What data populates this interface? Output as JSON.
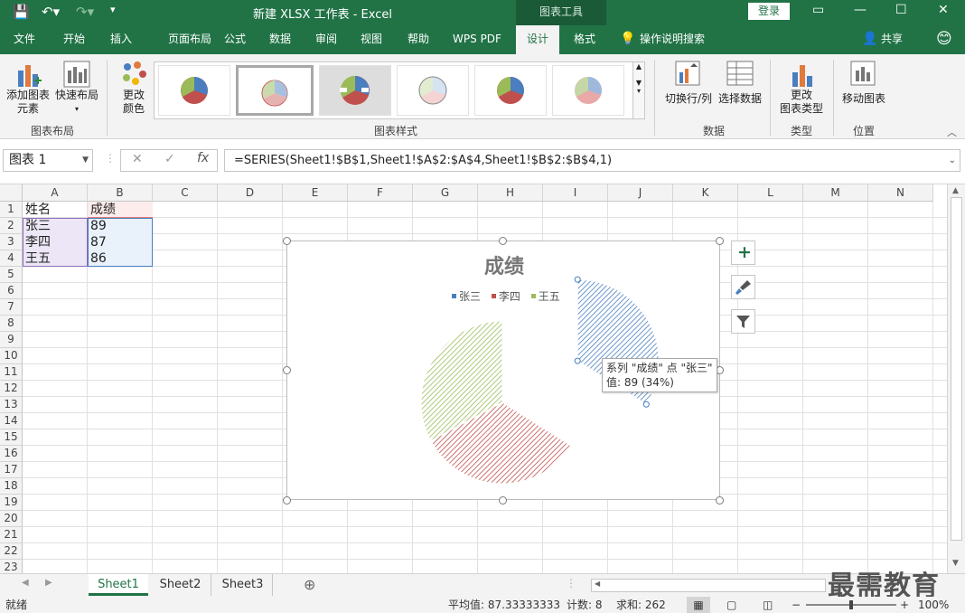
{
  "title_bar": {
    "document_title": "新建 XLSX 工作表 - Excel",
    "context_tools": "图表工具",
    "login_label": "登录"
  },
  "tabs": [
    {
      "label": "文件",
      "x": 0
    },
    {
      "label": "开始"
    },
    {
      "label": "插入"
    },
    {
      "label": "页面布局"
    },
    {
      "label": "公式"
    },
    {
      "label": "数据"
    },
    {
      "label": "审阅"
    },
    {
      "label": "视图"
    },
    {
      "label": "帮助"
    },
    {
      "label": "WPS PDF"
    },
    {
      "label": "设计"
    },
    {
      "label": "格式"
    }
  ],
  "tell_me": "操作说明搜索",
  "share": "共享",
  "ribbon": {
    "add_element": "添加图表\n元素",
    "quick_layout": "快速布局",
    "change_colors": "更改\n颜色",
    "switch_row_col": "切换行/列",
    "select_data": "选择数据",
    "change_type": "更改\n图表类型",
    "move_chart": "移动图表",
    "group_layout": "图表布局",
    "group_styles": "图表样式",
    "group_data": "数据",
    "group_type": "类型",
    "group_location": "位置"
  },
  "name_box": "图表 1",
  "formula": "=SERIES(Sheet1!$B$1,Sheet1!$A$2:$A$4,Sheet1!$B$2:$B$4,1)",
  "columns": [
    "A",
    "B",
    "C",
    "D",
    "E",
    "F",
    "G",
    "H",
    "I",
    "J",
    "K",
    "L",
    "M",
    "N"
  ],
  "rows": [
    "1",
    "2",
    "3",
    "4",
    "5",
    "6",
    "7",
    "8",
    "9",
    "10",
    "11",
    "12",
    "13",
    "14",
    "15",
    "16",
    "17",
    "18",
    "19",
    "20",
    "21",
    "22",
    "23"
  ],
  "cells": {
    "A1": "姓名",
    "B1": "成绩",
    "A2": "张三",
    "B2": "89",
    "A3": "李四",
    "B3": "87",
    "A4": "王五",
    "B4": "86"
  },
  "chart_data": {
    "type": "pie",
    "title": "成绩",
    "categories": [
      "张三",
      "李四",
      "王五"
    ],
    "values": [
      89,
      87,
      86
    ],
    "legend_position": "top",
    "exploded": "张三",
    "colors": [
      "#4a7ebf",
      "#c0504d",
      "#9bbb59"
    ]
  },
  "tooltip": {
    "line1": "系列 \"成绩\" 点 \"张三\"",
    "line2": "值: 89 (34%)"
  },
  "sheets": [
    "Sheet1",
    "Sheet2",
    "Sheet3"
  ],
  "status": {
    "ready": "就绪",
    "average": "平均值: 87.33333333",
    "count": "计数: 8",
    "sum": "求和: 262",
    "zoom": "100%"
  },
  "watermark": "最需教育"
}
